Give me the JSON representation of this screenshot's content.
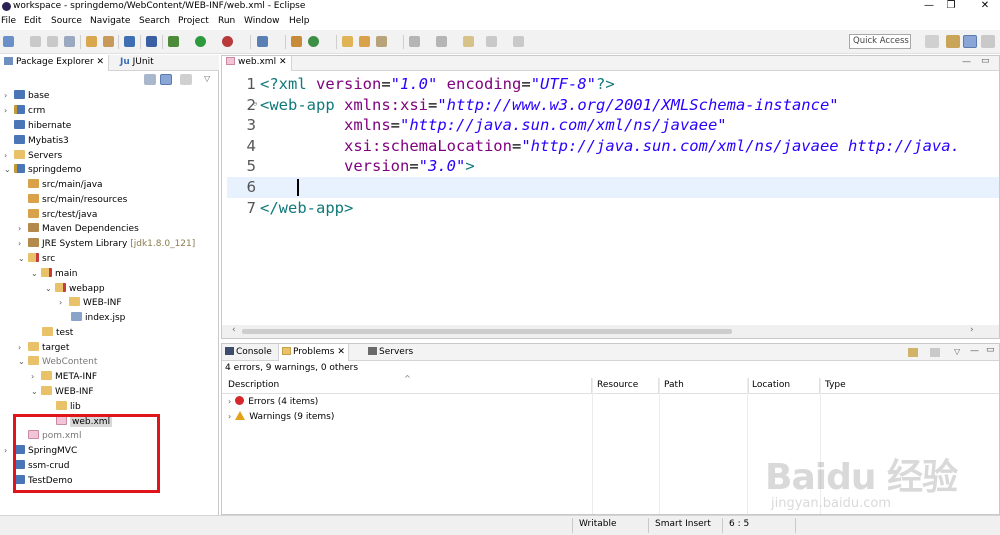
{
  "window": {
    "title": "workspace - springdemo/WebContent/WEB-INF/web.xml - Eclipse",
    "controls": [
      "—",
      "❐",
      "✕"
    ]
  },
  "menu": [
    "File",
    "Edit",
    "Source",
    "Navigate",
    "Search",
    "Project",
    "Run",
    "Window",
    "Help"
  ],
  "toolbar": {
    "quick_access": "Quick Access"
  },
  "package_explorer": {
    "tab_label": "Package Explorer",
    "tab2_label": "JUnit",
    "tab2_prefix": "Ju",
    "items": [
      {
        "label": "base",
        "suffix": ""
      },
      {
        "label": "crm",
        "suffix": ""
      },
      {
        "label": "hibernate",
        "suffix": ""
      },
      {
        "label": "Mybatis3",
        "suffix": ""
      },
      {
        "label": "Servers",
        "suffix": ""
      },
      {
        "label": "springdemo",
        "suffix": ""
      },
      {
        "label": "src/main/java",
        "suffix": ""
      },
      {
        "label": "src/main/resources",
        "suffix": ""
      },
      {
        "label": "src/test/java",
        "suffix": ""
      },
      {
        "label": "Maven Dependencies",
        "suffix": ""
      },
      {
        "label": "JRE System Library",
        "suffix": "[jdk1.8.0_121]"
      },
      {
        "label": "src",
        "suffix": ""
      },
      {
        "label": "main",
        "suffix": ""
      },
      {
        "label": "webapp",
        "suffix": ""
      },
      {
        "label": "WEB-INF",
        "suffix": ""
      },
      {
        "label": "index.jsp",
        "suffix": ""
      },
      {
        "label": "test",
        "suffix": ""
      },
      {
        "label": "target",
        "suffix": ""
      },
      {
        "label": "WebContent",
        "suffix": ""
      },
      {
        "label": "META-INF",
        "suffix": ""
      },
      {
        "label": "WEB-INF",
        "suffix": ""
      },
      {
        "label": "lib",
        "suffix": ""
      },
      {
        "label": "web.xml",
        "suffix": ""
      },
      {
        "label": "pom.xml",
        "suffix": ""
      },
      {
        "label": "SpringMVC",
        "suffix": ""
      },
      {
        "label": "ssm-crud",
        "suffix": ""
      },
      {
        "label": "TestDemo",
        "suffix": ""
      }
    ]
  },
  "editor": {
    "tab_label": "web.xml",
    "line_numbers": [
      "1",
      "2",
      "3",
      "4",
      "5",
      "6",
      "7"
    ],
    "lines": {
      "l1_open": "<?xml ",
      "l1_attr1": "version",
      "l1_eq1": "=",
      "l1_val1": "\"1.0\"",
      "l1_attr2": " encoding",
      "l1_eq2": "=",
      "l1_val2": "\"UTF-8\"",
      "l1_close": "?>",
      "l2_open": "<web-app ",
      "l2_attr": "xmlns:xsi",
      "l2_eq": "=",
      "l2_val": "\"http://www.w3.org/2001/XMLSchema-instance\"",
      "l3_indent": "         ",
      "l3_attr": "xmlns",
      "l3_eq": "=",
      "l3_val": "\"http://java.sun.com/xml/ns/javaee\"",
      "l4_indent": "         ",
      "l4_attr": "xsi:schemaLocation",
      "l4_eq": "=",
      "l4_val": "\"http://java.sun.com/xml/ns/javaee http://java.",
      "l5_indent": "         ",
      "l5_attr": "version",
      "l5_eq": "=",
      "l5_val": "\"3.0\"",
      "l5_close": ">",
      "l7": "</web-app>"
    }
  },
  "bottom_panel": {
    "tabs": [
      "Console",
      "Problems",
      "Servers"
    ],
    "summary": "4 errors, 9 warnings, 0 others",
    "columns": [
      "Description",
      "Resource",
      "Path",
      "Location",
      "Type"
    ],
    "rows": [
      {
        "label": "Errors (4 items)"
      },
      {
        "label": "Warnings (9 items)"
      }
    ]
  },
  "statusbar": {
    "mode": "Writable",
    "insert": "Smart Insert",
    "position": "6 : 5"
  },
  "watermark": {
    "logo": "Baidu 经验",
    "url": "jingyan.baidu.com"
  },
  "colors": {
    "tag": "#117979",
    "attr": "#7f007f",
    "value": "#2a00ff",
    "highlight": "#e0151a",
    "current_line": "#e8f2fe"
  }
}
